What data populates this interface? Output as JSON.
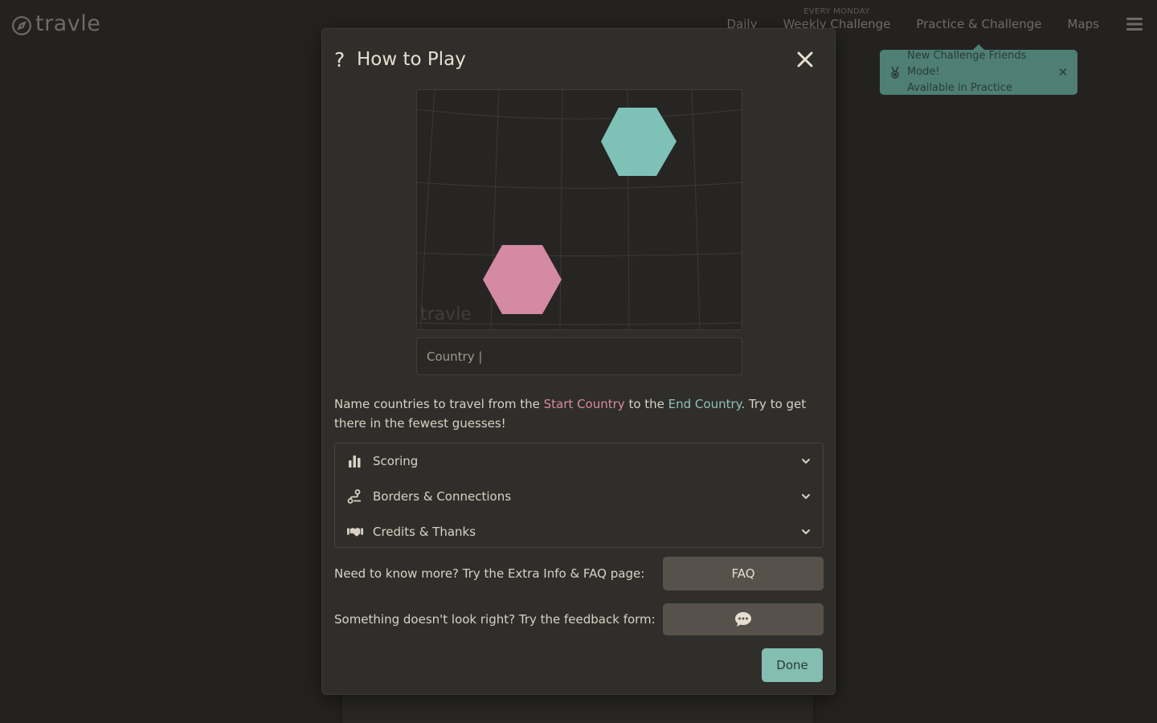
{
  "app": {
    "logo_text": "travle"
  },
  "nav": {
    "items": [
      {
        "label": "Daily"
      },
      {
        "label": "Weekly Challenge",
        "overline": "EVERY MONDAY"
      },
      {
        "label": "Practice & Challenge"
      },
      {
        "label": "Maps"
      }
    ]
  },
  "toast": {
    "line1": "New Challenge Friends Mode!",
    "line2": "Available in Practice",
    "close": "✕"
  },
  "modal": {
    "title": "How to Play",
    "question_icon": "?",
    "close_icon": "x-close-icon",
    "map": {
      "watermark": "travle",
      "start_color": "#d48aa2",
      "end_color": "#7ec1b6"
    },
    "input_value": "Country |",
    "intro": {
      "part1": "Name countries to travel from the ",
      "start": "Start Country",
      "part2": " to the ",
      "end": "End Country",
      "part3": ". Try to get there in the fewest guesses!"
    },
    "accordion": [
      {
        "label": "Scoring",
        "icon": "bar-chart-icon"
      },
      {
        "label": "Borders & Connections",
        "icon": "route-icon"
      },
      {
        "label": "Credits & Thanks",
        "icon": "handshake-icon"
      }
    ],
    "faq_row": {
      "label": "Need to know more? Try the Extra Info & FAQ page:",
      "button": "FAQ"
    },
    "feedback_row": {
      "label": "Something doesn't look right? Try the feedback form:",
      "button_icon": "chat-bubble-icon"
    },
    "done": "Done"
  },
  "colors": {
    "accent_teal": "#84bdb2",
    "start_pink": "#d88aa5",
    "end_teal": "#8cc4b8"
  }
}
